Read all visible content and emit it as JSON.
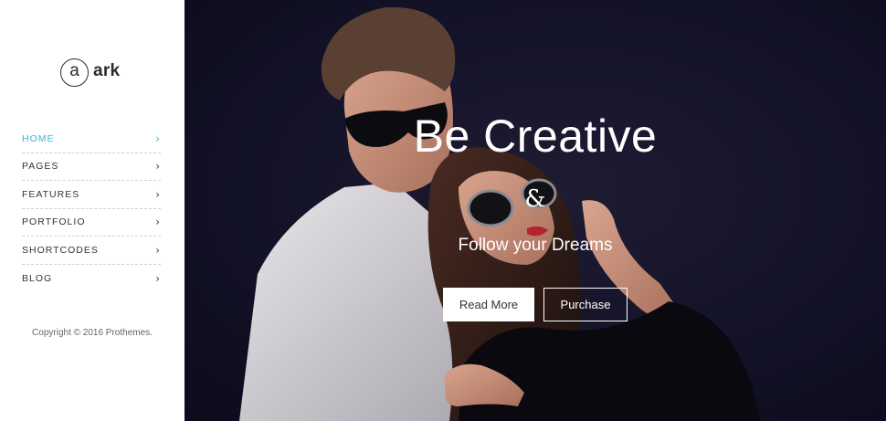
{
  "brand": {
    "logo_letter": "a",
    "name": "ark"
  },
  "nav": {
    "items": [
      {
        "label": "HOME",
        "active": true
      },
      {
        "label": "PAGES",
        "active": false
      },
      {
        "label": "FEATURES",
        "active": false
      },
      {
        "label": "PORTFOLIO",
        "active": false
      },
      {
        "label": "SHORTCODES",
        "active": false
      },
      {
        "label": "BLOG",
        "active": false
      }
    ],
    "chevron": "›",
    "chevron_icon": "chevron-right-icon"
  },
  "footer": {
    "copyright": "Copyright © 2016 Prothemes."
  },
  "hero": {
    "title": "Be Creative",
    "ampersand": "&",
    "subtitle": "Follow your Dreams",
    "primary_button": "Read More",
    "secondary_button": "Purchase"
  },
  "colors": {
    "accent": "#3bb5d6",
    "hero_background": "#15142a",
    "text_dark": "#333333"
  }
}
